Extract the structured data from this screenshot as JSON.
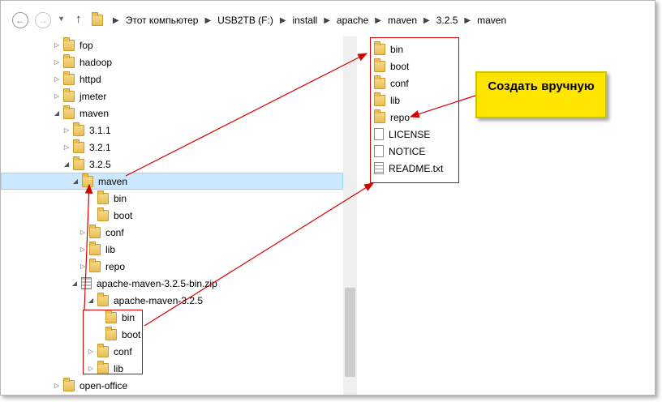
{
  "address_bar": {
    "back_icon": "arrow-left-icon",
    "forward_icon": "arrow-right-icon",
    "recent_icon": "chevron-down-icon",
    "up_icon": "arrow-up-icon",
    "separator": "▶",
    "crumbs": [
      "Этот компьютер",
      "USB2TB (F:)",
      "install",
      "apache",
      "maven",
      "3.2.5",
      "maven"
    ]
  },
  "tree": {
    "rows": [
      {
        "label": "fop",
        "twisty": "▷",
        "icon": "folder"
      },
      {
        "label": "hadoop",
        "twisty": "▷",
        "icon": "folder"
      },
      {
        "label": "httpd",
        "twisty": "▷",
        "icon": "folder"
      },
      {
        "label": "jmeter",
        "twisty": "▷",
        "icon": "folder"
      },
      {
        "label": "maven",
        "twisty": "◢",
        "icon": "folder"
      },
      {
        "label": "3.1.1",
        "twisty": "▷",
        "icon": "folder"
      },
      {
        "label": "3.2.1",
        "twisty": "▷",
        "icon": "folder"
      },
      {
        "label": "3.2.5",
        "twisty": "◢",
        "icon": "folder"
      },
      {
        "label": "maven",
        "twisty": "◢",
        "icon": "folder",
        "selected": true
      },
      {
        "label": "bin",
        "twisty": "",
        "icon": "folder"
      },
      {
        "label": "boot",
        "twisty": "",
        "icon": "folder"
      },
      {
        "label": "conf",
        "twisty": "▷",
        "icon": "folder"
      },
      {
        "label": "lib",
        "twisty": "▷",
        "icon": "folder"
      },
      {
        "label": "repo",
        "twisty": "▷",
        "icon": "folder"
      },
      {
        "label": "apache-maven-3.2.5-bin.zip",
        "twisty": "◢",
        "icon": "zip"
      },
      {
        "label": "apache-maven-3.2.5",
        "twisty": "◢",
        "icon": "folder"
      },
      {
        "label": "bin",
        "twisty": "",
        "icon": "folder"
      },
      {
        "label": "boot",
        "twisty": "",
        "icon": "folder"
      },
      {
        "label": "conf",
        "twisty": "▷",
        "icon": "folder"
      },
      {
        "label": "lib",
        "twisty": "▷",
        "icon": "folder"
      },
      {
        "label": "open-office",
        "twisty": "▷",
        "icon": "folder"
      }
    ]
  },
  "content": {
    "items": [
      {
        "label": "bin",
        "icon": "folder"
      },
      {
        "label": "boot",
        "icon": "folder"
      },
      {
        "label": "conf",
        "icon": "folder"
      },
      {
        "label": "lib",
        "icon": "folder"
      },
      {
        "label": "repo",
        "icon": "folder"
      },
      {
        "label": "LICENSE",
        "icon": "file"
      },
      {
        "label": "NOTICE",
        "icon": "file"
      },
      {
        "label": "README.txt",
        "icon": "txt"
      }
    ]
  },
  "callout": {
    "text": "Создать вручную"
  },
  "colors": {
    "selection": "#cce8ff",
    "annotation_red": "#d40000",
    "callout_yellow": "#ffe400"
  }
}
